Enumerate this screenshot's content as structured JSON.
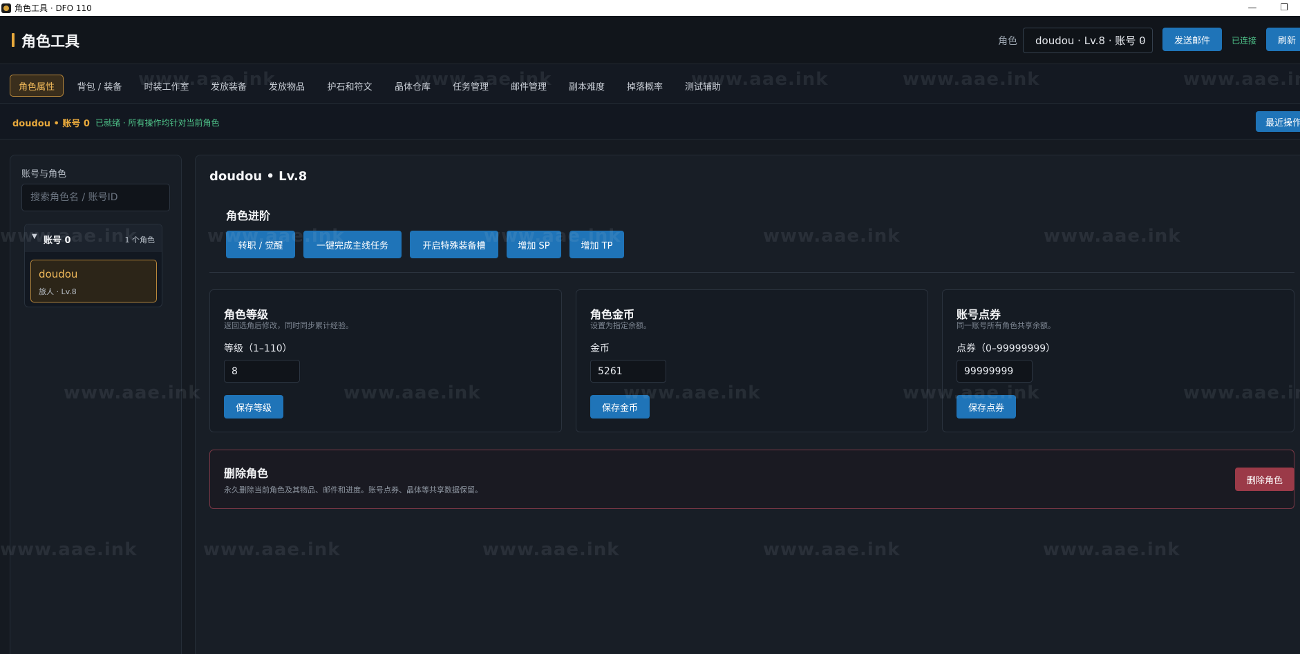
{
  "window": {
    "title": "角色工具 · DFO 110",
    "minimize_glyph": "—",
    "restore_glyph": "❐"
  },
  "header": {
    "title": "角色工具",
    "role_label": "角色",
    "role_selected": "doudou · Lv.8 · 账号 0",
    "send_mail_label": "发送邮件",
    "connection_status": "已连接",
    "refresh_label": "刷新"
  },
  "tabs": [
    {
      "label": "角色属性",
      "active": true
    },
    {
      "label": "背包 / 装备"
    },
    {
      "label": "时装工作室"
    },
    {
      "label": "发放装备"
    },
    {
      "label": "发放物品"
    },
    {
      "label": "护石和符文"
    },
    {
      "label": "晶体仓库"
    },
    {
      "label": "任务管理"
    },
    {
      "label": "邮件管理"
    },
    {
      "label": "副本难度"
    },
    {
      "label": "掉落概率"
    },
    {
      "label": "测试辅助"
    }
  ],
  "status": {
    "current": "doudou • 账号 0",
    "message": "已就绪 · 所有操作均针对当前角色",
    "recent_label": "最近操作"
  },
  "sidebar": {
    "title": "账号与角色",
    "search_placeholder": "搜索角色名 / 账号ID",
    "accounts": [
      {
        "toggle": "▼",
        "name": "账号 0",
        "count": "1 个角色",
        "characters": [
          {
            "name": "doudou",
            "sub": "旅人 · Lv.8"
          }
        ]
      }
    ]
  },
  "main": {
    "title": "doudou • Lv.8",
    "advance": {
      "title": "角色进阶",
      "buttons": [
        "转职 / 觉醒",
        "一键完成主线任务",
        "开启特殊装备槽",
        "增加 SP",
        "增加 TP"
      ]
    },
    "cards": [
      {
        "title": "角色等级",
        "desc": "返回选角后修改，同时同步累计经验。",
        "label": "等级（1–110）",
        "value": "8",
        "save_label": "保存等级"
      },
      {
        "title": "角色金币",
        "desc": "设置为指定余额。",
        "label": "金币",
        "value": "5261",
        "save_label": "保存金币"
      },
      {
        "title": "账号点券",
        "desc": "同一账号所有角色共享余额。",
        "label": "点券（0–99999999）",
        "value": "99999999",
        "save_label": "保存点券"
      }
    ],
    "danger": {
      "title": "删除角色",
      "desc": "永久删除当前角色及其物品、邮件和进度。账号点券、晶体等共享数据保留。",
      "delete_label": "删除角色"
    }
  },
  "watermark": "www.aae.ink",
  "colors": {
    "accent": "#e8a93c",
    "primary": "#1f74b8",
    "success": "#4fc48a",
    "danger": "#9b3a48",
    "background": "#151a21"
  }
}
